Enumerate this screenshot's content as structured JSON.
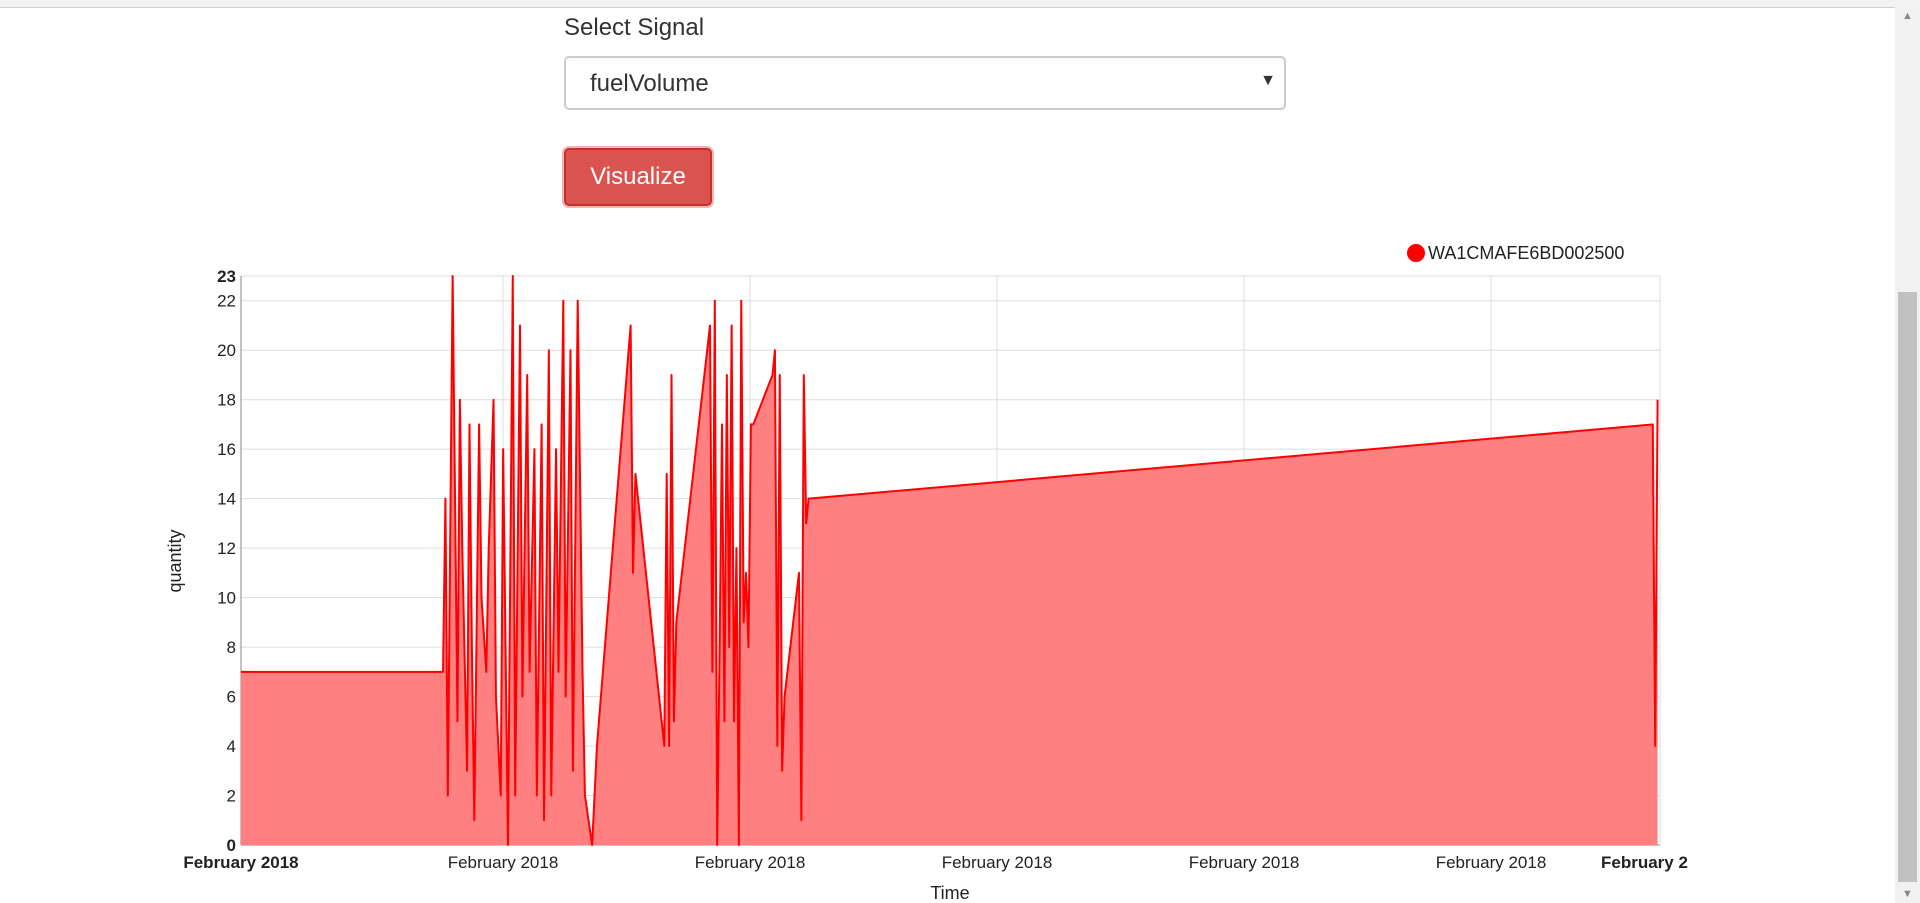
{
  "form": {
    "label": "Select Signal",
    "selected": "fuelVolume",
    "button_label": "Visualize"
  },
  "colors": {
    "series": "#ff0000",
    "fill": "#ff8080",
    "button": "#d9534f"
  },
  "icons": {
    "caret": "caret-down-icon",
    "legend": "legend-dot-icon"
  },
  "chart_data": {
    "type": "area",
    "xlabel": "Time",
    "ylabel": "quantity",
    "ylim": [
      0,
      23
    ],
    "grid": true,
    "legend_position": "top-right",
    "y_ticks": [
      "0",
      "2",
      "4",
      "6",
      "8",
      "10",
      "12",
      "14",
      "16",
      "18",
      "20",
      "22",
      "23"
    ],
    "x_ticks": [
      "February 2018",
      "February 2018",
      "February 2018",
      "February 2018",
      "February 2018",
      "February 2018",
      "February 2"
    ],
    "series": [
      {
        "name": "WA1CMAFE6BD002500",
        "points": [
          [
            0.0,
            7
          ],
          [
            8.4,
            7
          ],
          [
            8.5,
            14
          ],
          [
            8.6,
            2
          ],
          [
            8.8,
            23
          ],
          [
            9.0,
            5
          ],
          [
            9.1,
            18
          ],
          [
            9.2,
            12
          ],
          [
            9.4,
            3
          ],
          [
            9.5,
            17
          ],
          [
            9.6,
            8
          ],
          [
            9.7,
            1
          ],
          [
            9.9,
            17
          ],
          [
            10.0,
            10
          ],
          [
            10.2,
            7
          ],
          [
            10.3,
            12
          ],
          [
            10.5,
            18
          ],
          [
            10.6,
            6
          ],
          [
            10.8,
            2
          ],
          [
            10.9,
            16
          ],
          [
            11.1,
            0
          ],
          [
            11.3,
            23
          ],
          [
            11.4,
            2
          ],
          [
            11.6,
            21
          ],
          [
            11.7,
            6
          ],
          [
            11.9,
            19
          ],
          [
            12.0,
            7
          ],
          [
            12.2,
            16
          ],
          [
            12.3,
            2
          ],
          [
            12.5,
            17
          ],
          [
            12.6,
            1
          ],
          [
            12.8,
            20
          ],
          [
            12.9,
            2
          ],
          [
            13.1,
            16
          ],
          [
            13.2,
            7
          ],
          [
            13.4,
            22
          ],
          [
            13.5,
            6
          ],
          [
            13.7,
            20
          ],
          [
            13.8,
            3
          ],
          [
            14.0,
            22
          ],
          [
            14.2,
            7
          ],
          [
            14.3,
            2
          ],
          [
            14.6,
            0
          ],
          [
            14.8,
            4
          ],
          [
            16.2,
            21
          ],
          [
            16.3,
            11
          ],
          [
            16.4,
            15
          ],
          [
            17.6,
            4
          ],
          [
            17.7,
            15
          ],
          [
            17.8,
            4
          ],
          [
            17.9,
            19
          ],
          [
            18.0,
            5
          ],
          [
            18.1,
            9
          ],
          [
            19.5,
            21
          ],
          [
            19.6,
            7
          ],
          [
            19.7,
            22
          ],
          [
            19.8,
            0
          ],
          [
            19.9,
            8
          ],
          [
            20.0,
            17
          ],
          [
            20.1,
            5
          ],
          [
            20.2,
            19
          ],
          [
            20.3,
            8
          ],
          [
            20.4,
            21
          ],
          [
            20.5,
            5
          ],
          [
            20.6,
            12
          ],
          [
            20.7,
            0
          ],
          [
            20.8,
            22
          ],
          [
            20.9,
            9
          ],
          [
            21.0,
            11
          ],
          [
            21.1,
            8
          ],
          [
            21.2,
            17
          ],
          [
            21.3,
            17
          ],
          [
            22.1,
            19
          ],
          [
            22.2,
            20
          ],
          [
            22.3,
            4
          ],
          [
            22.4,
            19
          ],
          [
            22.5,
            3
          ],
          [
            22.6,
            6
          ],
          [
            23.2,
            11
          ],
          [
            23.3,
            1
          ],
          [
            23.4,
            19
          ],
          [
            23.5,
            13
          ],
          [
            23.6,
            14
          ],
          [
            58.7,
            17
          ],
          [
            58.8,
            4
          ],
          [
            58.9,
            18
          ]
        ]
      }
    ]
  }
}
